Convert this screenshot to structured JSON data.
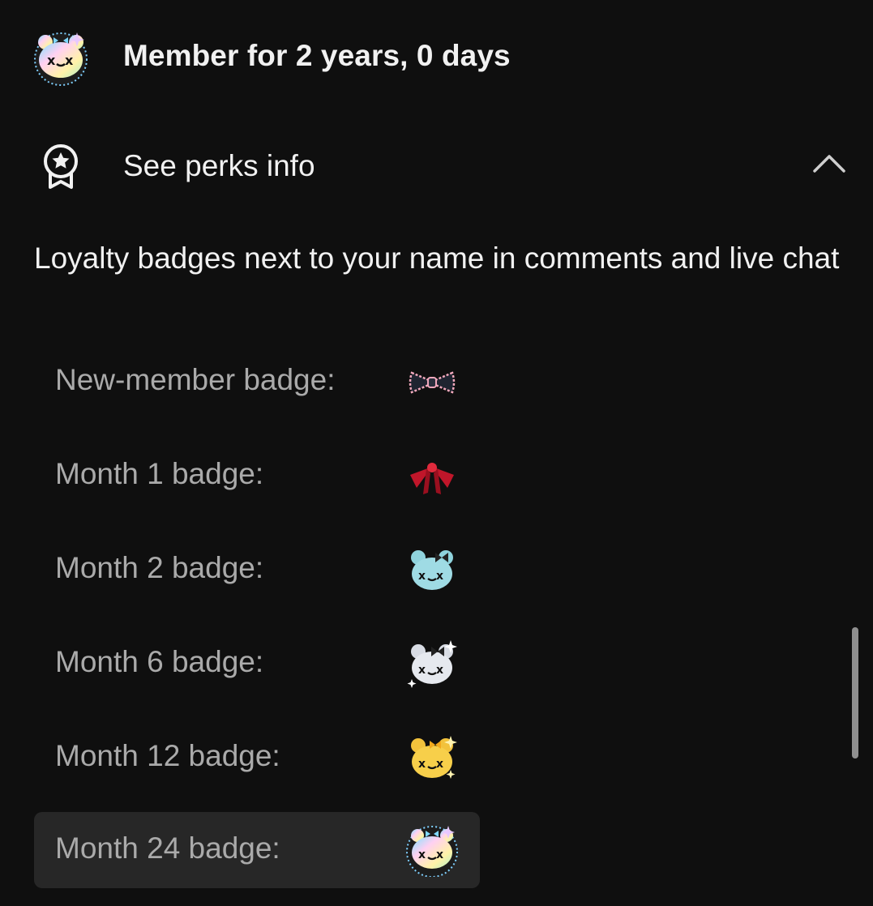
{
  "member": {
    "text": "Member for 2 years, 0 days",
    "avatar_icon": "bear-badge-icon"
  },
  "perks": {
    "toggle_label": "See perks info",
    "icon": "award-ribbon-icon",
    "expanded": true,
    "chevron_icon": "chevron-up-icon"
  },
  "perk_description": "Loyalty badges next to your name in comments and live chat",
  "badges": [
    {
      "label": "New-member badge:",
      "icon": "bowtie-icon"
    },
    {
      "label": "Month 1 badge:",
      "icon": "red-ribbon-icon"
    },
    {
      "label": "Month 2 badge:",
      "icon": "teal-bear-icon"
    },
    {
      "label": "Month 6 badge:",
      "icon": "silver-bear-icon"
    },
    {
      "label": "Month 12 badge:",
      "icon": "gold-bear-icon"
    },
    {
      "label": "Month 24 badge:",
      "icon": "rainbow-bear-icon",
      "highlighted": true
    }
  ],
  "colors": {
    "background": "#0f0f0f",
    "primary_text": "#f1f1f1",
    "secondary_text": "#aaaaaa",
    "highlight_row": "#272727"
  }
}
